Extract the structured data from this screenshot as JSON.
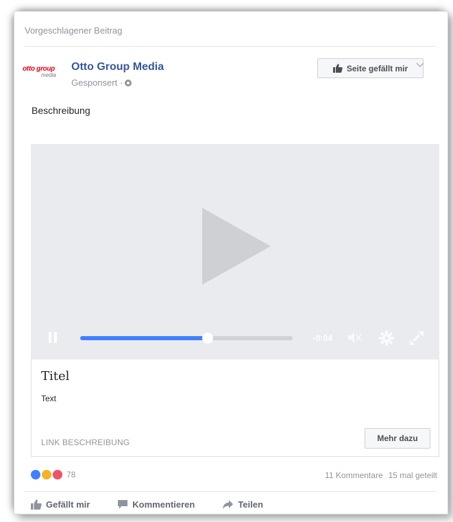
{
  "post": {
    "suggested_label": "Vorgeschlagener Beitrag",
    "page_name": "Otto Group Media",
    "sponsored_label": "Gesponsert ·",
    "like_page_label": "Seite gefällt mir",
    "description": "Beschreibung",
    "logo": {
      "line1": "otto group",
      "line2": "media",
      "color": "#e3001b"
    }
  },
  "video": {
    "time_remaining": "-0:04",
    "progress": 0.6,
    "progress_color": "#4080ff"
  },
  "card": {
    "title": "Titel",
    "text": "Text",
    "link_description": "LINK BESCHREIBUNG",
    "more_label": "Mehr dazu"
  },
  "engagement": {
    "reaction_count": "78",
    "comments": "11 Kommentare",
    "shares": "15 mal geteilt"
  },
  "actions": {
    "like": "Gefällt mir",
    "comment": "Kommentieren",
    "share": "Teilen"
  },
  "icons": [
    "thumbs-up-icon",
    "chevron-down-icon",
    "globe-icon",
    "play-icon",
    "pause-icon",
    "mute-icon",
    "gear-icon",
    "fullscreen-icon",
    "comment-icon",
    "share-icon"
  ]
}
